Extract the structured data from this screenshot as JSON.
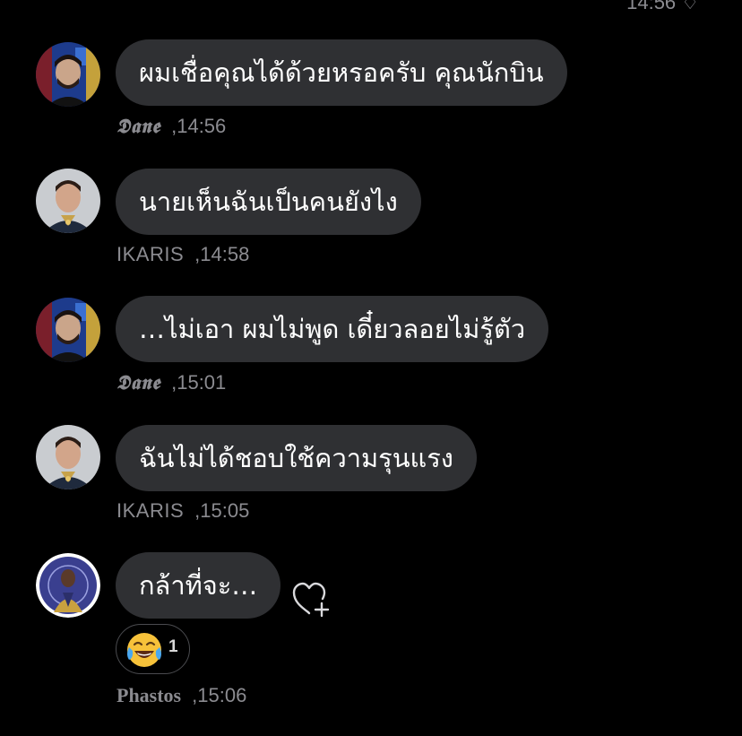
{
  "top_timestamp": "14:56 ♢",
  "messages": [
    {
      "sender": "𝕯𝖆𝖓𝖊",
      "text": "ผมเชื่อคุณได้ด้วยหรอครับ คุณนักบิน",
      "separator": ",",
      "time": "14:56",
      "avatar": "dane-avatar"
    },
    {
      "sender": "IKARIS",
      "text": "นายเห็นฉันเป็นคนยังไง",
      "separator": ",",
      "time": "14:58",
      "avatar": "ikaris-avatar"
    },
    {
      "sender": "𝕯𝖆𝖓𝖊",
      "text": "…ไม่เอา ผมไม่พูด เดี๋ยวลอยไม่รู้ตัว",
      "separator": ",",
      "time": "15:01",
      "avatar": "dane-avatar"
    },
    {
      "sender": "IKARIS",
      "text": "ฉันไม่ได้ชอบใช้ความรุนแรง",
      "separator": ",",
      "time": "15:05",
      "avatar": "ikaris-avatar"
    },
    {
      "sender": "Phastos",
      "text": "กล้าที่จะ…",
      "separator": ",",
      "time": "15:06",
      "avatar": "phastos-avatar",
      "reaction": {
        "emoji": "joy-tears-emoji",
        "count": "1"
      },
      "add_reaction_icon": "heart-plus-icon"
    }
  ],
  "colors": {
    "background": "#000000",
    "bubble": "#2f3033",
    "meta_text": "#8b8b90"
  }
}
